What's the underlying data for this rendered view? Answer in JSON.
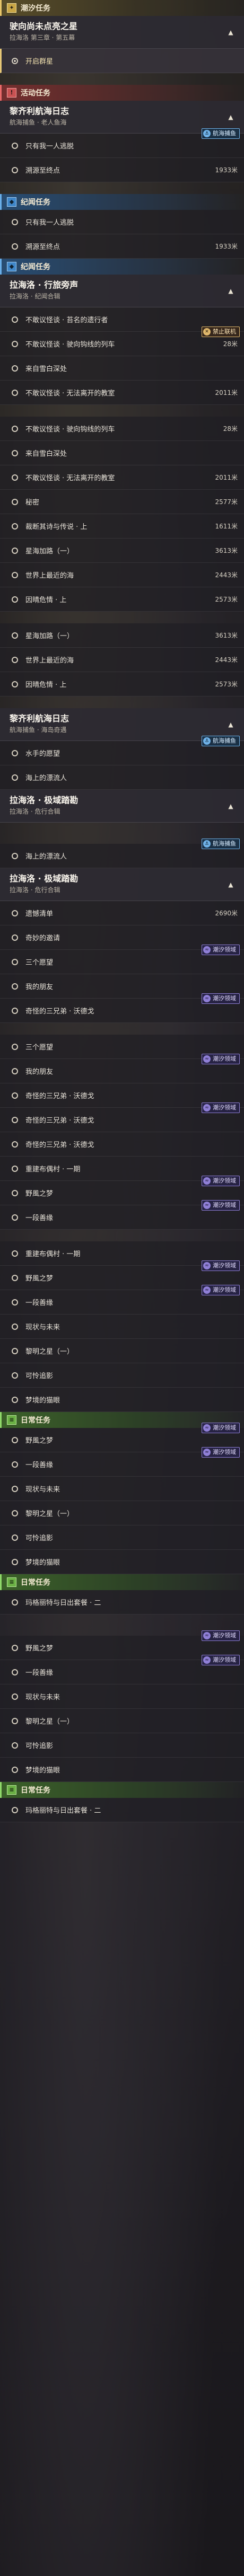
{
  "sections": {
    "tide": "潮汐任务",
    "activity": "活动任务",
    "lore": "纪闻任务",
    "daily": "日常任务"
  },
  "chapters": {
    "c1": {
      "title": "驶向尚未点亮之星",
      "sub": "拉海洛 第三章 · 第五幕"
    },
    "c2": {
      "title": "黎齐利航海日志",
      "sub": "航海捕鱼 · 老人鱼海"
    },
    "c3": {
      "title": "拉海洛 · 行旅旁声",
      "sub": "拉海洛 · 纪闻合辑"
    },
    "c4": {
      "title": "黎齐利航海日志",
      "sub": "航海捕鱼 · 海岛奇遇"
    },
    "c5": {
      "title": "拉海洛 · 极域踏勘",
      "sub": "拉海洛 · 危行合辑"
    },
    "c6": {
      "title": "拉海洛 · 极域踏勘",
      "sub": "拉海洛 · 危行合辑"
    }
  },
  "rows": {
    "r1": "开启群星",
    "r2": "只有我一人逃脱",
    "r3": "溯源至终点",
    "r3d": "1933米",
    "r4": "只有我一人逃脱",
    "r5": "溯源至终点",
    "r5d": "1933米",
    "r6": "不敢议怪谈 · 苔名的遗行者",
    "r7": "不敢议怪谈 · 驶向钩线的列车",
    "r7d": "28米",
    "r8": "来自雪白深处",
    "r9": "不敢议怪谈 · 无法离开的教室",
    "r9d": "2011米",
    "r10": "不敢议怪谈 · 驶向钩线的列车",
    "r10d": "28米",
    "r11": "来自雪白深处",
    "r12": "不敢议怪谈 · 无法离开的教室",
    "r12d": "2011米",
    "r13": "秘密",
    "r13d": "2577米",
    "r14": "裁断其诗与传说 · 上",
    "r14d": "1611米",
    "r15": "星海加路（一）",
    "r15d": "3613米",
    "r16": "世界上最近的海",
    "r16d": "2443米",
    "r17": "因晴危情 · 上",
    "r17d": "2573米",
    "r18": "星海加路（一）",
    "r18d": "3613米",
    "r19": "世界上最近的海",
    "r19d": "2443米",
    "r20": "因晴危情 · 上",
    "r20d": "2573米",
    "r21": "水手的愿望",
    "r22": "海上的漂流人",
    "r23": "海上的漂流人",
    "r24": "遗憾清单",
    "r24d": "2690米",
    "r25": "奇妙的邀请",
    "r26": "三个愿望",
    "r27": "我的朋友",
    "r28": "奇怪的三兄弟 · 沃德戈",
    "r29": "三个愿望",
    "r30": "我的朋友",
    "r31": "奇怪的三兄弟 · 沃德戈",
    "r32": "奇怪的三兄弟 · 沃德戈",
    "r33": "奇怪的三兄弟 · 沃德戈",
    "r34": "重建布偶村 · 一期",
    "r35": "野風之梦",
    "r36": "一段善缘",
    "r37": "重建布偶村 · 一期",
    "r38": "野風之梦",
    "r39": "一段善缘",
    "r40": "现状与未来",
    "r41": "黎明之星（一）",
    "r42": "可怜追影",
    "r43": "梦境的猫眼",
    "r44": "野風之梦",
    "r45": "一段善缘",
    "r46": "现状与未来",
    "r47": "黎明之星（一）",
    "r48": "可怜追影",
    "r49": "梦境的猫眼",
    "r50": "玛格丽特与日出套餐 · 二",
    "r51": "野風之梦",
    "r52": "一段善缘",
    "r53": "现状与未来",
    "r54": "黎明之星（一）",
    "r55": "可怜追影",
    "r56": "梦境的猫眼",
    "r57": "玛格丽特与日出套餐 · 二"
  },
  "badges": {
    "nav": "航海捕鱼",
    "lock": "禁止联机",
    "tide": "潮汐领域"
  },
  "toggle": "▲",
  "section_icons": {
    "tide": "✦",
    "activity": "!",
    "lore": "◆",
    "daily": "≡"
  },
  "colors": {
    "tide_accent": "#e8c66a",
    "activity_accent": "#e86a6a",
    "lore_accent": "#6aaee8",
    "daily_accent": "#8fd86a",
    "tide_badge": "#8f7fd6"
  }
}
